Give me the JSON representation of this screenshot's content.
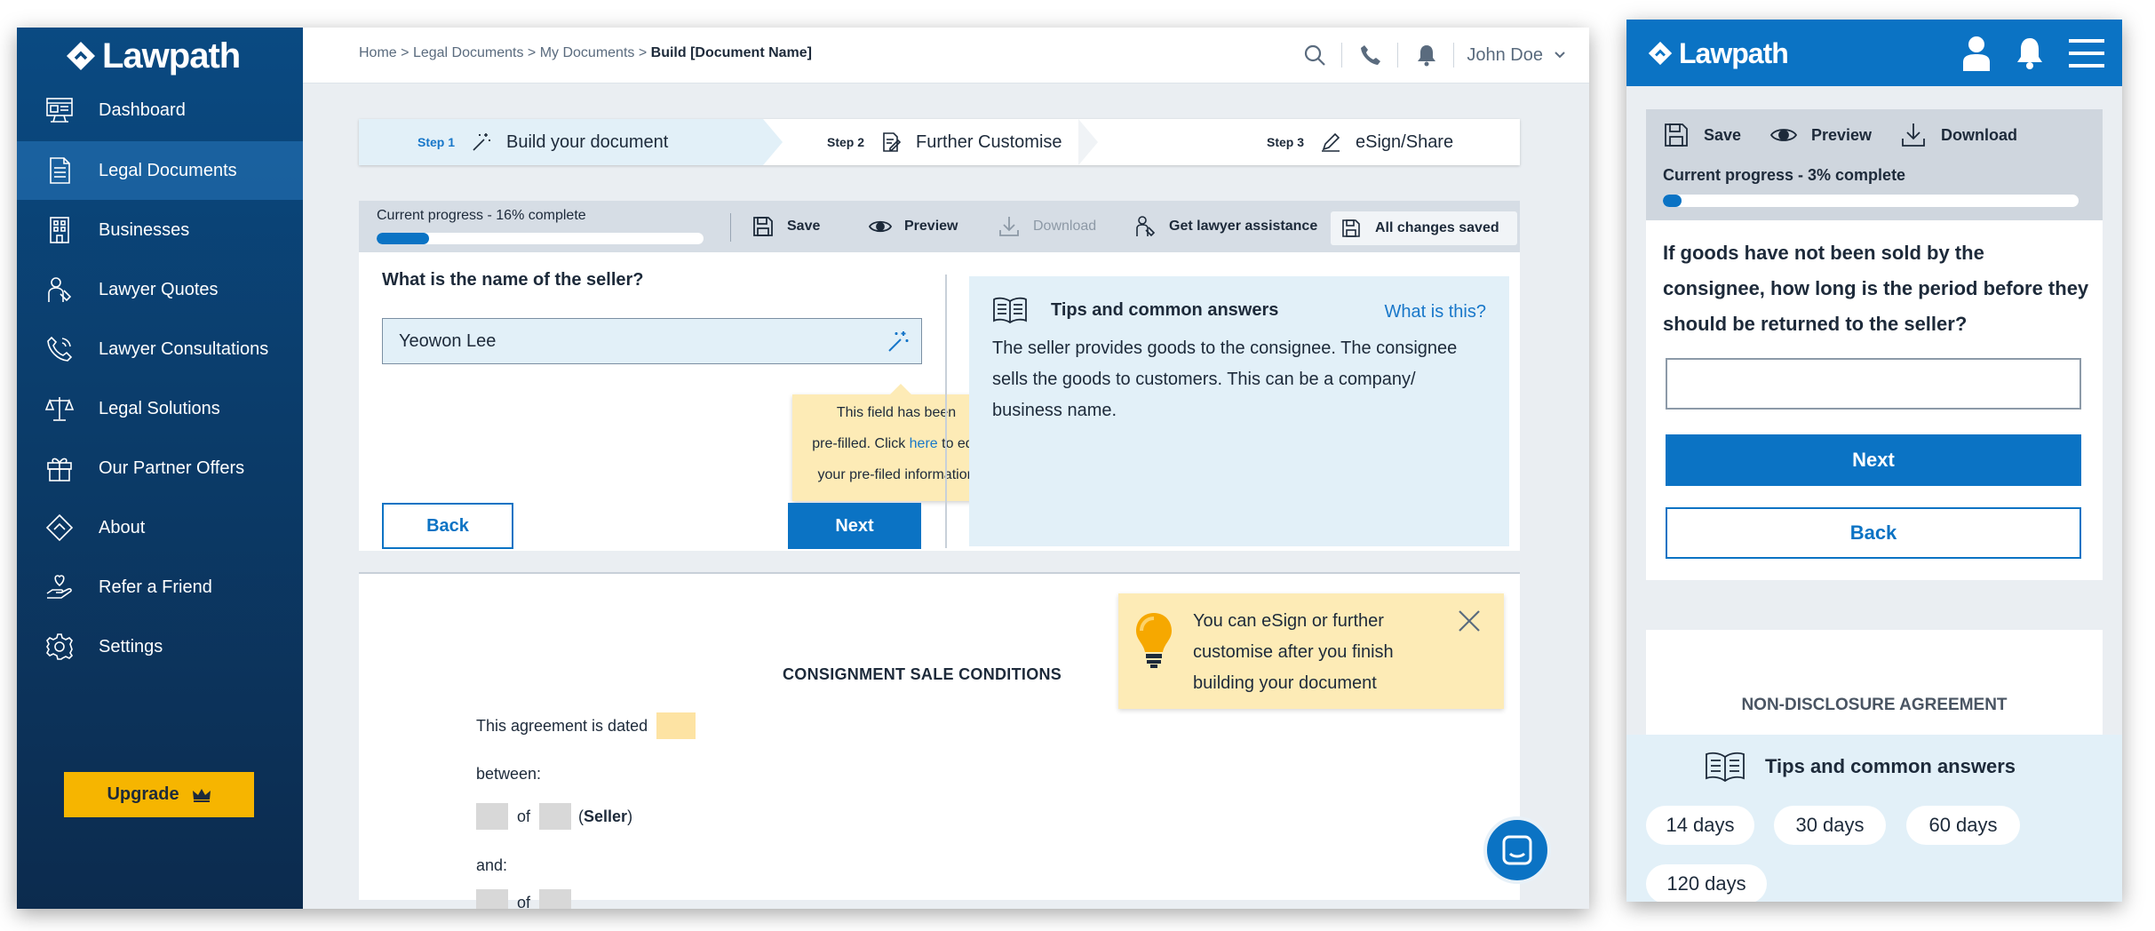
{
  "brand": {
    "name": "Lawpath"
  },
  "sidebar": {
    "items": [
      {
        "label": "Dashboard",
        "icon": "dashboard-icon"
      },
      {
        "label": "Legal Documents",
        "icon": "document-icon"
      },
      {
        "label": "Businesses",
        "icon": "building-icon"
      },
      {
        "label": "Lawyer Quotes",
        "icon": "lawyer-icon"
      },
      {
        "label": "Lawyer Consultations",
        "icon": "phone-icon"
      },
      {
        "label": "Legal Solutions",
        "icon": "scales-icon"
      },
      {
        "label": "Our Partner Offers",
        "icon": "gift-icon"
      },
      {
        "label": "About",
        "icon": "diamond-icon"
      },
      {
        "label": "Refer a Friend",
        "icon": "hand-heart-icon"
      },
      {
        "label": "Settings",
        "icon": "gear-icon"
      }
    ],
    "active_index": 1,
    "upgrade_label": "Upgrade"
  },
  "topbar": {
    "breadcrumb": {
      "home": "Home",
      "legal_documents": "Legal Documents",
      "my_documents": "My Documents",
      "current": "Build [Document Name]",
      "separator": ">"
    },
    "user_name": "John Doe"
  },
  "steps": [
    {
      "num": "Step 1",
      "label": "Build your document"
    },
    {
      "num": "Step 2",
      "label": "Further Customise"
    },
    {
      "num": "Step 3",
      "label": "eSign/Share"
    }
  ],
  "builder": {
    "progress_label": "Current progress - 16% complete",
    "progress": 0.16,
    "toolbar": {
      "save": "Save",
      "preview": "Preview",
      "download": "Download",
      "lawyer": "Get lawyer assistance",
      "saved": "All changes saved"
    },
    "question": "What is the name of the seller?",
    "answer": "Yeowon Lee",
    "tooltip": {
      "line1": "This field has been",
      "line2_pre": "pre-filled. Click ",
      "link": "here",
      "line2_post": " to edit",
      "line3": "your pre-filed information"
    },
    "back": "Back",
    "next": "Next"
  },
  "tips": {
    "title": "Tips and common answers",
    "what_is_this": "What is this?",
    "body": "The seller provides goods to the consignee. The consignee sells the goods to customers. This can be a company/ business name."
  },
  "document": {
    "title": "CONSIGNMENT SALE CONDITIONS",
    "dated": "This agreement is dated",
    "between": "between:",
    "of": "of",
    "seller": "Seller",
    "and": "and:"
  },
  "hint": {
    "text": "You can eSign or further customise after you finish building your document"
  },
  "mobile": {
    "toolbar": {
      "save": "Save",
      "preview": "Preview",
      "download": "Download"
    },
    "progress_label": "Current progress - 3% complete",
    "progress": 0.03,
    "question": "If goods have not been sold by the consignee, how long is the period before they should be returned to the seller?",
    "input_value": "",
    "next": "Next",
    "back": "Back",
    "doc_title": "NON-DISCLOSURE AGREEMENT",
    "tips_title": "Tips and common answers",
    "chips": [
      "14 days",
      "30 days",
      "60 days",
      "120 days"
    ]
  },
  "colors": {
    "primary": "#0b73c4",
    "sidebar": "#0b3c6a",
    "accent": "#f6b500",
    "tips_bg": "#e2f0f8",
    "hint_bg": "#fdebb6"
  }
}
